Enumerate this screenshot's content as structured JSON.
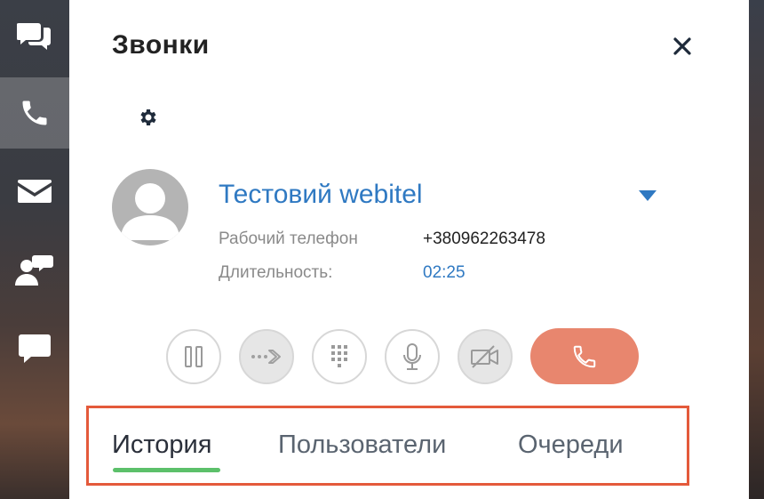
{
  "sidebar": {
    "items": [
      {
        "name": "chats",
        "icon": "chat-bubbles-icon",
        "active": false
      },
      {
        "name": "calls",
        "icon": "phone-icon",
        "active": true
      },
      {
        "name": "mail",
        "icon": "envelope-icon",
        "active": false
      },
      {
        "name": "contacts",
        "icon": "user-chat-icon",
        "active": false
      },
      {
        "name": "messages",
        "icon": "message-icon",
        "active": false
      }
    ]
  },
  "header": {
    "title": "Звонки",
    "close_icon": "close-icon",
    "settings_icon": "gear-icon"
  },
  "call": {
    "contact_name": "Тестовий webitel",
    "phone_label": "Рабочий телефон",
    "phone_value": "+380962263478",
    "duration_label": "Длительность:",
    "duration_value": "02:25"
  },
  "controls": [
    {
      "name": "hold",
      "icon": "pause-icon",
      "enabled": true
    },
    {
      "name": "transfer",
      "icon": "transfer-arrow-icon",
      "enabled": false
    },
    {
      "name": "dialpad",
      "icon": "dialpad-icon",
      "enabled": true
    },
    {
      "name": "microphone",
      "icon": "microphone-icon",
      "enabled": true
    },
    {
      "name": "video",
      "icon": "video-off-icon",
      "enabled": false
    },
    {
      "name": "hangup",
      "icon": "phone-hangup-icon",
      "enabled": true
    }
  ],
  "tabs": [
    {
      "label": "История",
      "active": true
    },
    {
      "label": "Пользователи",
      "active": false
    },
    {
      "label": "Очереди",
      "active": false
    }
  ],
  "colors": {
    "accent_blue": "#2f79c2",
    "hangup": "#e8866e",
    "tab_active_underline": "#5cc06a",
    "highlight_box": "#e45a3b"
  }
}
